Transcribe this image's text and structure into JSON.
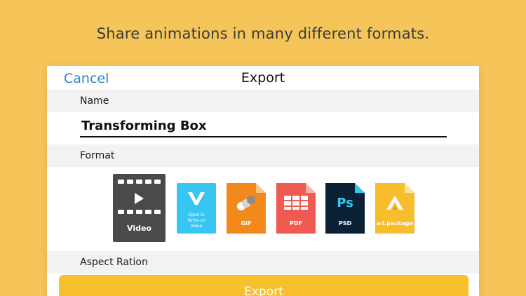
{
  "tagline": "Share animations in many different formats.",
  "nav": {
    "cancel_label": "Cancel",
    "title": "Export"
  },
  "name_section": {
    "header": "Name",
    "value": "Transforming Box"
  },
  "format_section": {
    "header": "Format",
    "formats": [
      {
        "id": "video",
        "label": "Video",
        "color": "#4a4a4a",
        "icon": "film-play-icon"
      },
      {
        "id": "write-on",
        "label": "Open in\nWrite-on\nVideo",
        "color": "#37c5f4",
        "icon": "write-on-v-icon"
      },
      {
        "id": "gif",
        "label": "GIF",
        "color": "#f28a1b",
        "icon": "gif-dots-icon"
      },
      {
        "id": "pdf",
        "label": "PDF",
        "color": "#ef5b52",
        "icon": "pdf-pages-icon"
      },
      {
        "id": "psd",
        "label": "PSD",
        "color": "#0b2236",
        "icon": "photoshop-icon",
        "icon_text": "Ps"
      },
      {
        "id": "adpackage",
        "label": "ad.package",
        "color": "#f8bd2d",
        "icon": "ad-package-icon"
      }
    ]
  },
  "aspect_section": {
    "header": "Aspect Ration"
  },
  "export_button": {
    "label": "Export"
  },
  "colors": {
    "background": "#f5c55a",
    "accent_link": "#2f86c8",
    "export_button": "#f8c12b"
  }
}
